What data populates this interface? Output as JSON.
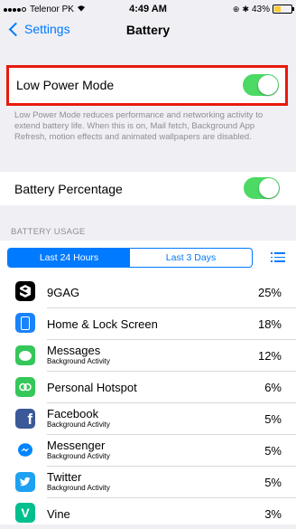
{
  "status_bar": {
    "carrier": "Telenor PK",
    "time": "4:49 AM",
    "battery": "43%"
  },
  "nav": {
    "back_label": "Settings",
    "title": "Battery"
  },
  "low_power": {
    "label": "Low Power Mode",
    "on": true,
    "footnote": "Low Power Mode reduces performance and networking activity to extend battery life.  When this is on, Mail fetch, Background App Refresh, motion effects and animated wallpapers are disabled."
  },
  "battery_percentage": {
    "label": "Battery Percentage",
    "on": true
  },
  "usage": {
    "header": "BATTERY USAGE",
    "tabs": [
      "Last 24 Hours",
      "Last 3 Days"
    ],
    "active_tab": 0,
    "apps": [
      {
        "name": "9GAG",
        "sub": "",
        "pct": "25%",
        "icon": "9gag-icon",
        "color": "#000000",
        "glyph": "9"
      },
      {
        "name": "Home & Lock Screen",
        "sub": "",
        "pct": "18%",
        "icon": "phone-screen-icon",
        "color": "#1a82fb",
        "glyph": "▯"
      },
      {
        "name": "Messages",
        "sub": "Background Activity",
        "pct": "12%",
        "icon": "messages-icon",
        "color": "#34c759",
        "glyph": "💬"
      },
      {
        "name": "Personal Hotspot",
        "sub": "",
        "pct": "6%",
        "icon": "hotspot-icon",
        "color": "#34c759",
        "glyph": "∞"
      },
      {
        "name": "Facebook",
        "sub": "Background Activity",
        "pct": "5%",
        "icon": "facebook-icon",
        "color": "#3b5998",
        "glyph": "f"
      },
      {
        "name": "Messenger",
        "sub": "Background Activity",
        "pct": "5%",
        "icon": "messenger-icon",
        "color": "#ffffff",
        "glyph": "⚡"
      },
      {
        "name": "Twitter",
        "sub": "Background Activity",
        "pct": "5%",
        "icon": "twitter-icon",
        "color": "#1da1f2",
        "glyph": "🐦"
      },
      {
        "name": "Vine",
        "sub": "",
        "pct": "3%",
        "icon": "vine-icon",
        "color": "#00bf8f",
        "glyph": "V"
      }
    ]
  },
  "colors": {
    "accent": "#007aff",
    "toggle_on": "#4cd964",
    "highlight_box": "#e8190d"
  }
}
